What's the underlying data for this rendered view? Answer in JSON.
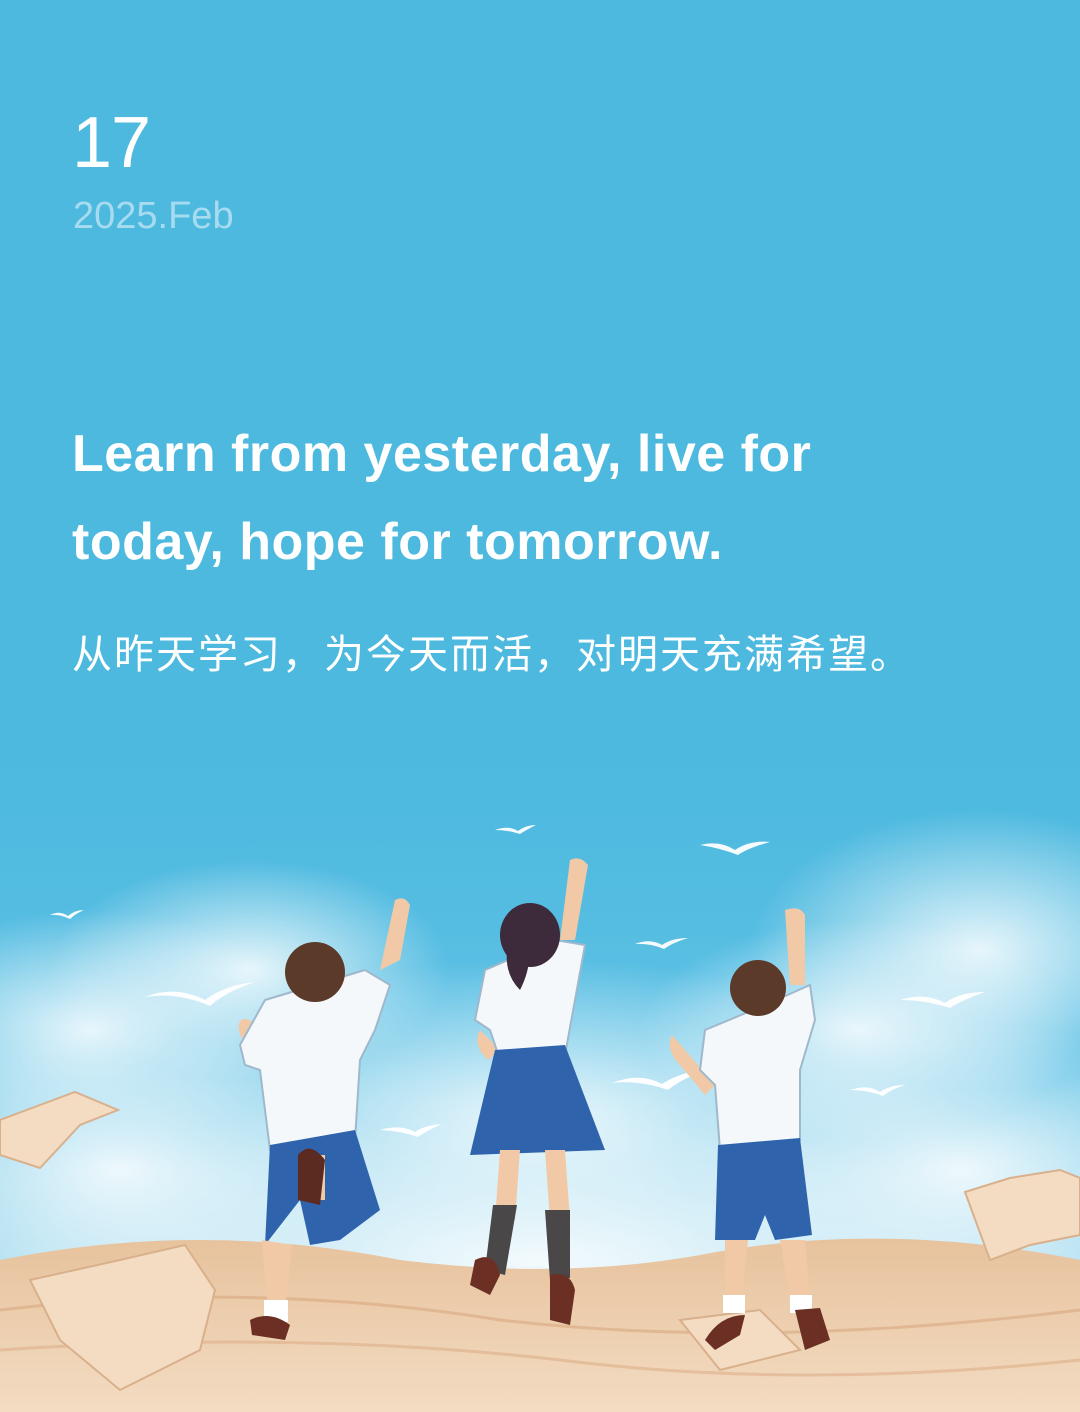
{
  "date": {
    "day": "17",
    "year_month": "2025.Feb"
  },
  "quote": {
    "english": "Learn from yesterday, live for today, hope for tomorrow.",
    "chinese": "从昨天学习，为今天而活，对明天充满希望。"
  },
  "colors": {
    "sky": "#4db9df",
    "date_secondary": "#a7dbf0",
    "text": "#ffffff",
    "uniform_blue": "#2f64ad",
    "shirt_white": "#f4f8fb",
    "ground": "#e9c9a8"
  },
  "illustration": {
    "icon": "students-jumping-illustration"
  }
}
